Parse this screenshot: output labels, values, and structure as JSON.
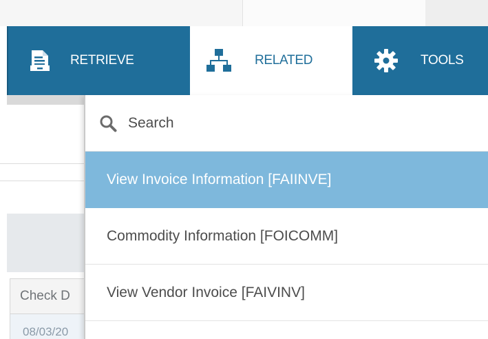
{
  "toolbar": {
    "retrieve_label": "RETRIEVE",
    "related_label": "RELATED",
    "tools_label": "TOOLS",
    "icons": {
      "retrieve": "document-retrieve-icon",
      "related": "sitemap-icon",
      "tools": "gear-icon"
    }
  },
  "related_menu": {
    "search_icon": "search-icon",
    "search_placeholder": "Search",
    "items": [
      {
        "label": "View Invoice Information [FAIINVE]",
        "highlighted": true
      },
      {
        "label": "Commodity Information [FOICOMM]",
        "highlighted": false
      },
      {
        "label": "View Vendor Invoice [FAIVINV]",
        "highlighted": false
      }
    ]
  },
  "background_form": {
    "check_column_header": "Check D",
    "check_value": "08/03/20"
  },
  "colors": {
    "toolbar_bg": "#1f6e9a",
    "highlight_bg": "#7eb8dc",
    "text": "#4c4c4c"
  }
}
